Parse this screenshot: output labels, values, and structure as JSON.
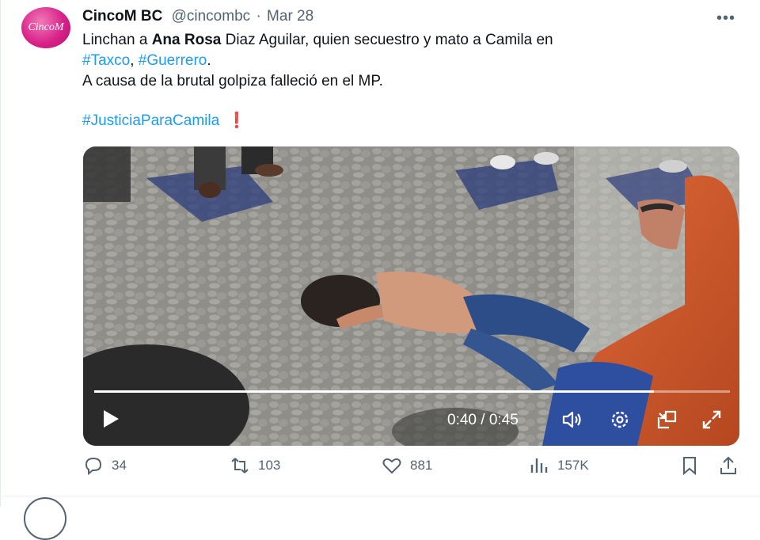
{
  "tweet": {
    "author_name": "CincoM BC",
    "handle": "@cincombc",
    "separator": "·",
    "date": "Mar 28",
    "avatar_text": "CincoM",
    "more_label": "•••",
    "text": {
      "l1a": "Linchan a ",
      "l1b": "Ana Rosa",
      "l1c": " Diaz Aguilar, quien secuestro y mato a Camila en",
      "l2tag1": "#Taxco",
      "l2sep": ", ",
      "l2tag2": "#Guerrero",
      "l2end": ".",
      "l3": "A causa de la brutal golpiza falleció en el MP.",
      "hashtag": "#JusticiaParaCamila",
      "emoji": "❗"
    }
  },
  "video": {
    "elapsed": "0:40",
    "duration": "0:45",
    "time_sep": " / ",
    "progress": 0.88,
    "controls": [
      "play-icon",
      "volume-icon",
      "settings-icon",
      "pip-icon",
      "fullscreen-icon"
    ]
  },
  "actions": {
    "replies": "34",
    "reposts": "103",
    "likes": "881",
    "views": "157K"
  },
  "colors": {
    "link": "#1d9bf0",
    "muted": "#536471",
    "accent_avatar": "#d9238a",
    "alert": "#e0245e"
  }
}
